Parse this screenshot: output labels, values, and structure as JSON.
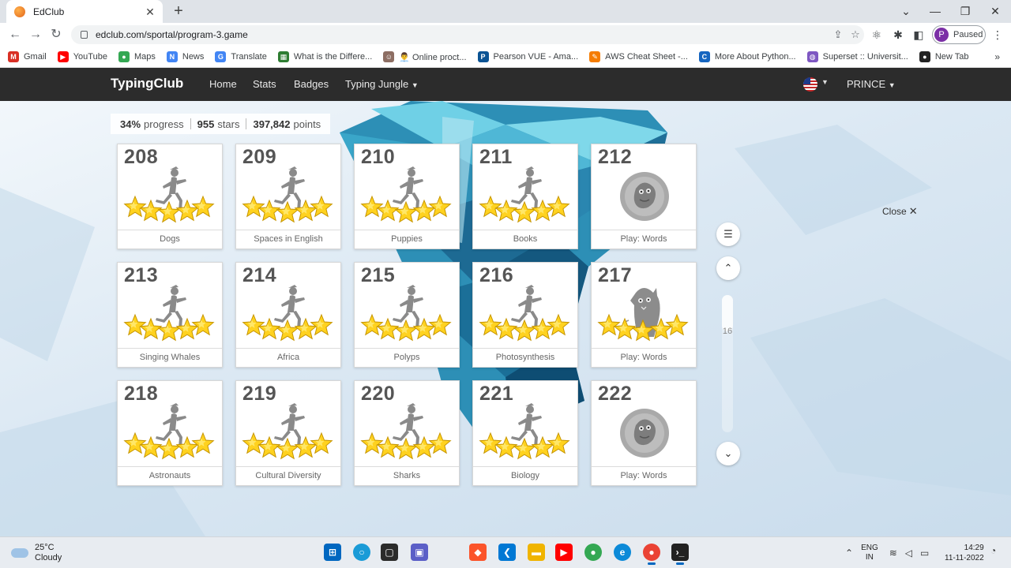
{
  "browser": {
    "tab_title": "EdClub",
    "url": "edclub.com/sportal/program-3.game",
    "profile_initial": "P",
    "profile_status": "Paused",
    "bookmarks": [
      {
        "label": "Gmail",
        "color": "#d93025",
        "glyph": "M"
      },
      {
        "label": "YouTube",
        "color": "#ff0000",
        "glyph": "▶"
      },
      {
        "label": "Maps",
        "color": "#34a853",
        "glyph": "●"
      },
      {
        "label": "News",
        "color": "#4285f4",
        "glyph": "N"
      },
      {
        "label": "Translate",
        "color": "#4285f4",
        "glyph": "G"
      },
      {
        "label": "What is the Differe...",
        "color": "#2e7d32",
        "glyph": "▦"
      },
      {
        "label": "👨‍💼 Online proct...",
        "color": "#8d6e63",
        "glyph": "☺"
      },
      {
        "label": "Pearson VUE - Ama...",
        "color": "#0b5394",
        "glyph": "P"
      },
      {
        "label": "AWS Cheat Sheet -...",
        "color": "#f57c00",
        "glyph": "✎"
      },
      {
        "label": "More About Python...",
        "color": "#1565c0",
        "glyph": "C"
      },
      {
        "label": "Superset :: Universit...",
        "color": "#7e57c2",
        "glyph": "◍"
      },
      {
        "label": "New Tab",
        "color": "#222222",
        "glyph": "●"
      }
    ]
  },
  "site": {
    "brand": "TypingClub",
    "nav": [
      "Home",
      "Stats",
      "Badges",
      "Typing Jungle"
    ],
    "user": "PRINCE"
  },
  "stats": {
    "progress": "34%",
    "progress_label": "progress",
    "stars": "955",
    "stars_label": "stars",
    "points": "397,842",
    "points_label": "points"
  },
  "lessons": [
    {
      "number": "208",
      "title": "Dogs",
      "type": "runner",
      "stars": 5
    },
    {
      "number": "209",
      "title": "Spaces in English",
      "type": "runner",
      "stars": 5
    },
    {
      "number": "210",
      "title": "Puppies",
      "type": "runner",
      "stars": 5
    },
    {
      "number": "211",
      "title": "Books",
      "type": "runner",
      "stars": 5
    },
    {
      "number": "212",
      "title": "Play: Words",
      "type": "game-badge",
      "stars": 0
    },
    {
      "number": "213",
      "title": "Singing Whales",
      "type": "runner",
      "stars": 5
    },
    {
      "number": "214",
      "title": "Africa",
      "type": "runner",
      "stars": 5
    },
    {
      "number": "215",
      "title": "Polyps",
      "type": "runner",
      "stars": 5
    },
    {
      "number": "216",
      "title": "Photosynthesis",
      "type": "runner",
      "stars": 5
    },
    {
      "number": "217",
      "title": "Play: Words",
      "type": "monster",
      "stars": 5
    },
    {
      "number": "218",
      "title": "Astronauts",
      "type": "runner",
      "stars": 5
    },
    {
      "number": "219",
      "title": "Cultural Diversity",
      "type": "runner",
      "stars": 5
    },
    {
      "number": "220",
      "title": "Sharks",
      "type": "runner",
      "stars": 5
    },
    {
      "number": "221",
      "title": "Biology",
      "type": "runner",
      "stars": 5
    },
    {
      "number": "222",
      "title": "Play: Words",
      "type": "game-badge",
      "stars": 0
    }
  ],
  "panel": {
    "close_label": "Close",
    "page_number": "16"
  },
  "taskbar": {
    "temperature": "25°C",
    "weather": "Cloudy",
    "lang_top": "ENG",
    "lang_bottom": "IN",
    "time": "14:29",
    "date": "11-11-2022"
  }
}
